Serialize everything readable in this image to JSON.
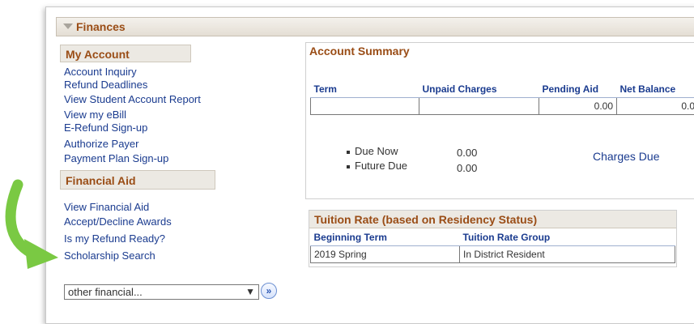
{
  "section_title": "Finances",
  "my_account": {
    "title": "My Account",
    "links": [
      "Account Inquiry",
      "Refund Deadlines",
      "View Student Account Report",
      "View my eBill",
      "E-Refund Sign-up",
      "Authorize Payer",
      "Payment Plan Sign-up"
    ]
  },
  "financial_aid": {
    "title": "Financial Aid",
    "links": [
      "View Financial Aid",
      "Accept/Decline Awards",
      "Is my Refund Ready?",
      "Scholarship Search"
    ]
  },
  "account_summary": {
    "title": "Account Summary",
    "columns": [
      "Term",
      "Unpaid Charges",
      "Pending Aid",
      "Net Balance"
    ],
    "row": [
      "",
      "",
      "0.00",
      "0.0"
    ],
    "due": [
      {
        "label": "Due Now",
        "value": "0.00"
      },
      {
        "label": "Future Due",
        "value": "0.00"
      }
    ],
    "charges_due_link": "Charges Due"
  },
  "tuition_rate": {
    "title": "Tuition Rate (based on Residency Status)",
    "columns": [
      "Beginning Term",
      "Tuition Rate Group"
    ],
    "row": [
      "2019 Spring",
      "In District Resident"
    ]
  },
  "other_financial": {
    "selected": "other financial...",
    "go_label": "»"
  },
  "colors": {
    "accent": "#9a4d16",
    "link": "#1a3b8f",
    "arrow": "#7ac943"
  }
}
